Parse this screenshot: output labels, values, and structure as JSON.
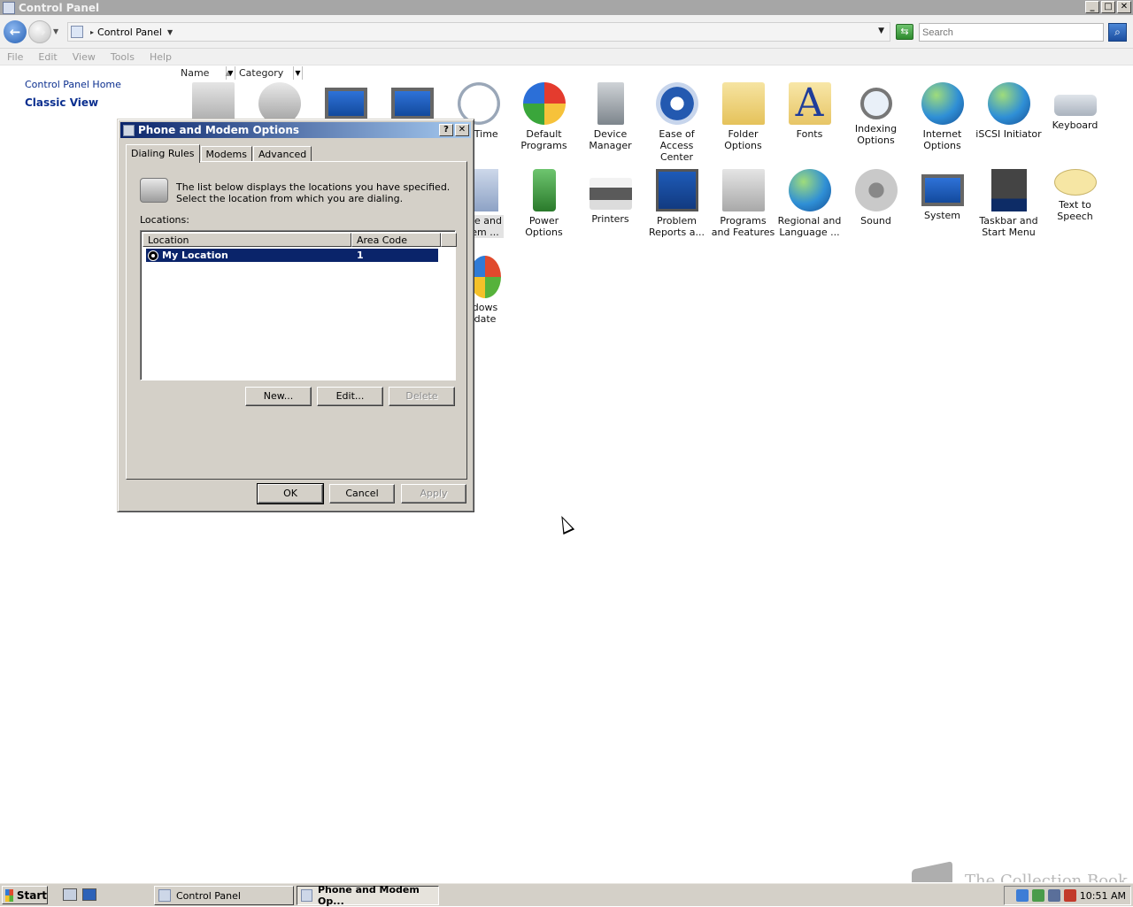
{
  "window": {
    "title": "Control Panel",
    "buttons": [
      "_",
      "□",
      "✕"
    ]
  },
  "addressbar": {
    "location": "Control Panel",
    "search_placeholder": "Search"
  },
  "menu": [
    "File",
    "Edit",
    "View",
    "Tools",
    "Help"
  ],
  "leftpane": {
    "home_link": "Control Panel Home",
    "classic_link": "Classic View"
  },
  "columns": {
    "name": "Name",
    "category": "Category"
  },
  "items": [
    {
      "label": "",
      "icon": "admin-tools-icon"
    },
    {
      "label": "",
      "icon": "autoplay-icon"
    },
    {
      "label": "",
      "icon": "backup-icon"
    },
    {
      "label": "",
      "icon": "color-icon"
    },
    {
      "label": "nd Time",
      "icon": "date-time-icon"
    },
    {
      "label": "Default Programs",
      "icon": "default-programs-icon"
    },
    {
      "label": "Device Manager",
      "icon": "device-manager-icon"
    },
    {
      "label": "Ease of Access Center",
      "icon": "ease-of-access-icon"
    },
    {
      "label": "Folder Options",
      "icon": "folder-options-icon"
    },
    {
      "label": "Fonts",
      "icon": "fonts-icon"
    },
    {
      "label": "Indexing Options",
      "icon": "indexing-options-icon"
    },
    {
      "label": "Internet Options",
      "icon": "internet-options-icon"
    },
    {
      "label": "iSCSI Initiator",
      "icon": "iscsi-initiator-icon"
    },
    {
      "label": "Keyboard",
      "icon": "keyboard-icon"
    },
    {
      "label": "ne and em ...",
      "icon": "phone-modem-icon"
    },
    {
      "label": "Power Options",
      "icon": "power-options-icon"
    },
    {
      "label": "Printers",
      "icon": "printers-icon"
    },
    {
      "label": "Problem Reports a...",
      "icon": "problem-reports-icon"
    },
    {
      "label": "Programs and Features",
      "icon": "programs-features-icon"
    },
    {
      "label": "Regional and Language ...",
      "icon": "regional-language-icon"
    },
    {
      "label": "Sound",
      "icon": "sound-icon"
    },
    {
      "label": "System",
      "icon": "system-icon"
    },
    {
      "label": "Taskbar and Start Menu",
      "icon": "taskbar-start-menu-icon"
    },
    {
      "label": "Text to Speech",
      "icon": "text-to-speech-icon"
    },
    {
      "label": "dows date",
      "icon": "windows-update-icon"
    }
  ],
  "dialog": {
    "title": "Phone and Modem Options",
    "help_btn": "?",
    "close_btn": "✕",
    "tabs": [
      "Dialing Rules",
      "Modems",
      "Advanced"
    ],
    "info_text": "The list below displays the locations you have specified. Select the location from which you are dialing.",
    "locations_label": "Locations:",
    "columns": [
      "Location",
      "Area Code"
    ],
    "rows": [
      {
        "location": "My Location",
        "area_code": "1"
      }
    ],
    "buttons": {
      "new": "New...",
      "edit": "Edit...",
      "delete": "Delete",
      "ok": "OK",
      "cancel": "Cancel",
      "apply": "Apply"
    }
  },
  "taskbar": {
    "start": "Start",
    "tasks": [
      "Control Panel",
      "Phone and Modem Op..."
    ],
    "clock": "10:51 AM"
  },
  "watermark": "The Collection Book"
}
